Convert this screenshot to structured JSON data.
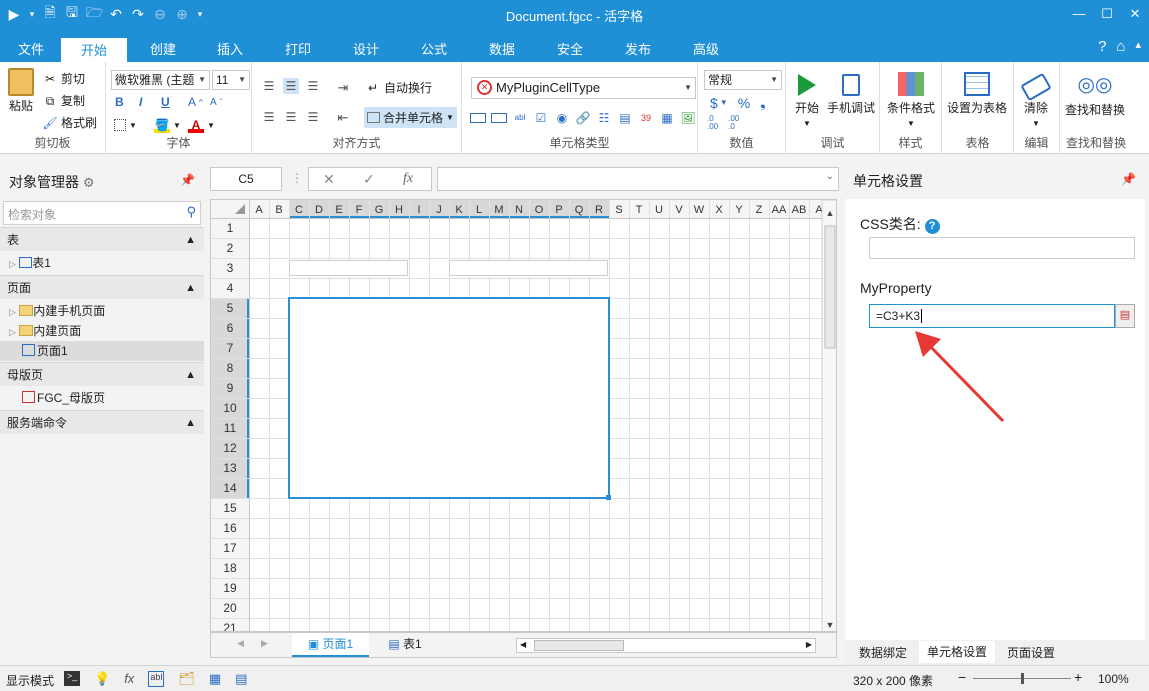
{
  "titlebar": {
    "title": "Document.fgcc - 活字格",
    "quick_access": [
      "▶",
      "▾",
      "🗎",
      "🖫",
      "🗁",
      "↶",
      "↷",
      "⊖",
      "⊕",
      "▾"
    ],
    "window": [
      "—",
      "☐",
      "✕"
    ]
  },
  "tabs": [
    "文件",
    "开始",
    "创建",
    "插入",
    "打印",
    "设计",
    "公式",
    "数据",
    "安全",
    "发布",
    "高级"
  ],
  "ribbon": {
    "clipboard": {
      "paste": "粘贴",
      "cut": "剪切",
      "copy": "复制",
      "format_painter": "格式刷",
      "group": "剪切板"
    },
    "font": {
      "family": "微软雅黑 (主题",
      "size": "11",
      "bold": "B",
      "italic": "I",
      "underline": "U",
      "grow": "A",
      "shrink": "A",
      "group": "字体"
    },
    "align": {
      "wrap": "自动换行",
      "merge": "合并单元格",
      "group": "对齐方式"
    },
    "celltype": {
      "value": "MyPluginCellType",
      "group": "单元格类型"
    },
    "number": {
      "format": "常规",
      "currency": "$",
      "percent": "%",
      "comma": "❟",
      "group": "数值"
    },
    "debug": {
      "start": "开始",
      "mobile": "手机调试",
      "group": "调试"
    },
    "style": {
      "cond": "条件格式",
      "group": "样式"
    },
    "table": {
      "set": "设置为表格",
      "group": "表格"
    },
    "edit": {
      "clear": "清除",
      "group": "编辑"
    },
    "find": {
      "label": "查找和替换",
      "group": "查找和替换"
    }
  },
  "left_panel": {
    "title": "对象管理器",
    "search_placeholder": "检索对象",
    "sections": {
      "tables": "表",
      "pages": "页面",
      "master": "母版页",
      "server": "服务端命令"
    },
    "items": {
      "table1": "表1",
      "mobile_pages": "内建手机页面",
      "pages_builtin": "内建页面",
      "page1": "页面1",
      "master1": "FGC_母版页"
    }
  },
  "formula": {
    "namebox": "C5",
    "cancel": "✕",
    "confirm": "✓",
    "fx": "fx",
    "value": ""
  },
  "sheet": {
    "columns": [
      "A",
      "B",
      "C",
      "D",
      "E",
      "F",
      "G",
      "H",
      "I",
      "J",
      "K",
      "L",
      "M",
      "N",
      "O",
      "P",
      "Q",
      "R",
      "S",
      "T",
      "U",
      "V",
      "W",
      "X",
      "Y",
      "Z",
      "AA",
      "AB",
      "A"
    ],
    "rows": [
      "1",
      "2",
      "3",
      "4",
      "5",
      "6",
      "7",
      "8",
      "9",
      "10",
      "11",
      "12",
      "13",
      "14",
      "15",
      "16",
      "17",
      "18",
      "19",
      "20",
      "21"
    ],
    "active_cell": "C5",
    "tabs": [
      "页面1",
      "表1"
    ]
  },
  "right_panel": {
    "title": "单元格设置",
    "css_label": "CSS类名:",
    "css_value": "",
    "property_label": "MyProperty",
    "property_value": "=C3+K3",
    "tabs": [
      "数据绑定",
      "单元格设置",
      "页面设置"
    ],
    "active_tab": "单元格设置"
  },
  "status": {
    "mode": "显示模式",
    "size": "320 x 200 像素",
    "zoom": "100%",
    "zoom_level": 1.0
  },
  "colors": {
    "accent": "#1f8fd6",
    "selection": "#2b8fd6",
    "arrow": "#e53935",
    "header_sel": "#d8d8d8"
  }
}
